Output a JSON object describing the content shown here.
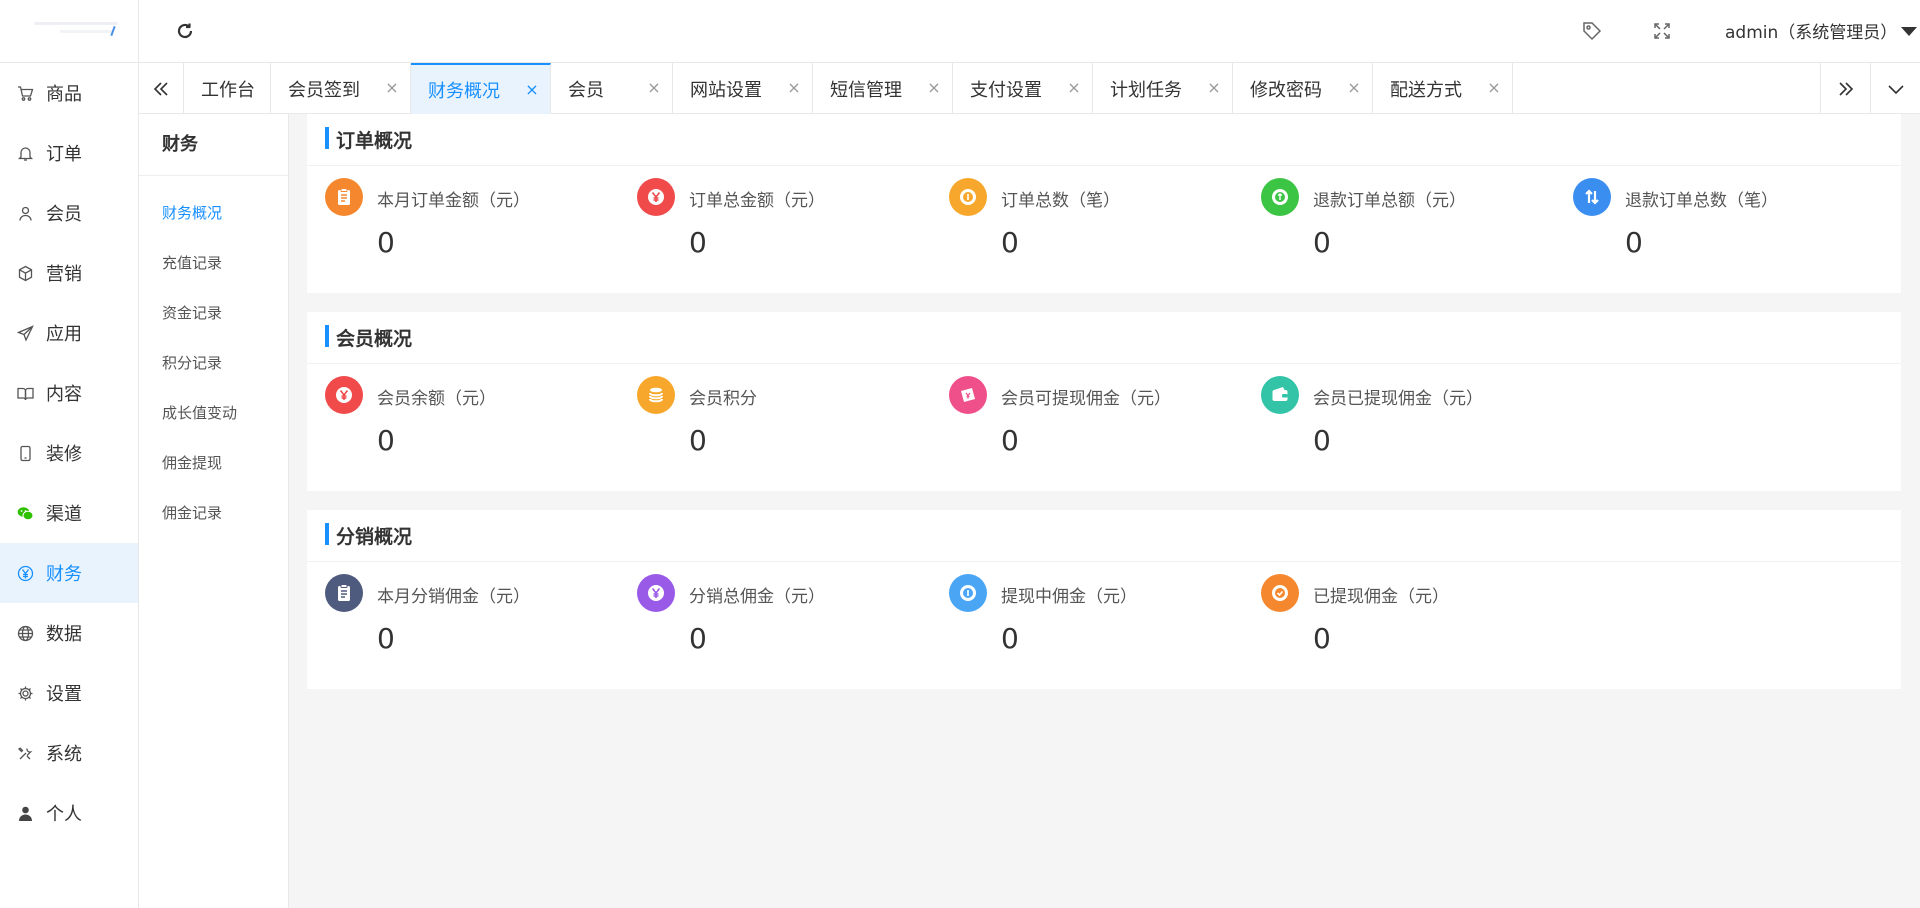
{
  "sidebar": {
    "items": [
      {
        "label": "商品",
        "icon": "cart-icon"
      },
      {
        "label": "订单",
        "icon": "bell-icon"
      },
      {
        "label": "会员",
        "icon": "user-icon"
      },
      {
        "label": "营销",
        "icon": "cube-icon"
      },
      {
        "label": "应用",
        "icon": "send-icon"
      },
      {
        "label": "内容",
        "icon": "book-icon"
      },
      {
        "label": "装修",
        "icon": "phone-icon"
      },
      {
        "label": "渠道",
        "icon": "wechat-icon"
      },
      {
        "label": "财务",
        "icon": "yen-icon",
        "active": true
      },
      {
        "label": "数据",
        "icon": "globe-icon"
      },
      {
        "label": "设置",
        "icon": "gear-icon"
      },
      {
        "label": "系统",
        "icon": "tools-icon"
      },
      {
        "label": "个人",
        "icon": "person-icon"
      }
    ]
  },
  "header": {
    "user": "admin（系统管理员）"
  },
  "tabs": [
    {
      "label": "工作台",
      "closable": false
    },
    {
      "label": "会员签到",
      "closable": true
    },
    {
      "label": "财务概况",
      "closable": true,
      "active": true
    },
    {
      "label": "会员",
      "closable": true
    },
    {
      "label": "网站设置",
      "closable": true
    },
    {
      "label": "短信管理",
      "closable": true
    },
    {
      "label": "支付设置",
      "closable": true
    },
    {
      "label": "计划任务",
      "closable": true
    },
    {
      "label": "修改密码",
      "closable": true
    },
    {
      "label": "配送方式",
      "closable": true
    }
  ],
  "subsidebar": {
    "title": "财务",
    "items": [
      "财务概况",
      "充值记录",
      "资金记录",
      "积分记录",
      "成长值变动",
      "佣金提现",
      "佣金记录"
    ]
  },
  "sections": [
    {
      "title": "订单概况",
      "stats": [
        {
          "label": "本月订单金额（元）",
          "value": "0",
          "color": "#f5882e",
          "icon": "clipboard-icon"
        },
        {
          "label": "订单总金额（元）",
          "value": "0",
          "color": "#f04a4a",
          "icon": "yen-coin-icon"
        },
        {
          "label": "订单总数（笔）",
          "value": "0",
          "color": "#f7a82c",
          "icon": "coin-icon"
        },
        {
          "label": "退款订单总额（元）",
          "value": "0",
          "color": "#3cc444",
          "icon": "refund-coin-icon"
        },
        {
          "label": "退款订单总数（笔）",
          "value": "0",
          "color": "#3a8ef0",
          "icon": "swap-arrows-icon"
        }
      ]
    },
    {
      "title": "会员概况",
      "stats": [
        {
          "label": "会员余额（元）",
          "value": "0",
          "color": "#f04a4a",
          "icon": "yen-coin-icon"
        },
        {
          "label": "会员积分",
          "value": "0",
          "color": "#f7a82c",
          "icon": "coins-stack-icon"
        },
        {
          "label": "会员可提现佣金（元）",
          "value": "0",
          "color": "#f0508a",
          "icon": "cash-icon"
        },
        {
          "label": "会员已提现佣金（元）",
          "value": "0",
          "color": "#33c4a8",
          "icon": "wallet-icon"
        }
      ]
    },
    {
      "title": "分销概况",
      "stats": [
        {
          "label": "本月分销佣金（元）",
          "value": "0",
          "color": "#4f5b7e",
          "icon": "clipboard-icon"
        },
        {
          "label": "分销总佣金（元）",
          "value": "0",
          "color": "#9a5ae8",
          "icon": "yen-coin-icon"
        },
        {
          "label": "提现中佣金（元）",
          "value": "0",
          "color": "#4aa6f5",
          "icon": "pending-coin-icon"
        },
        {
          "label": "已提现佣金（元）",
          "value": "0",
          "color": "#f5882e",
          "icon": "check-coin-icon"
        }
      ]
    }
  ]
}
